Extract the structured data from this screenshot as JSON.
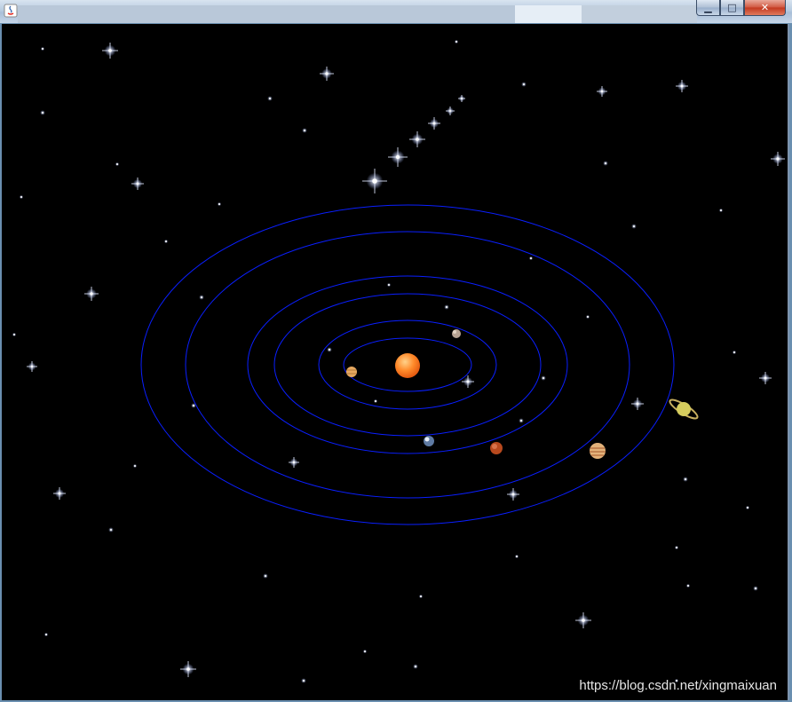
{
  "window": {
    "title": "",
    "buttons": {
      "minimize": "▁",
      "maximize": "□",
      "close": "✕"
    }
  },
  "scene": {
    "orbit_color": "#0a1fff",
    "background": "#000000",
    "sun": {
      "name": "sun",
      "color": "#ff7a1a"
    },
    "planets": [
      {
        "name": "mercury",
        "color": "#c9a98c"
      },
      {
        "name": "venus",
        "color": "#e8b36a"
      },
      {
        "name": "earth",
        "color": "#6e86a8"
      },
      {
        "name": "mars",
        "color": "#b8491e"
      },
      {
        "name": "jupiter",
        "color": "#e0a96a"
      },
      {
        "name": "saturn",
        "color": "#d8cc60"
      }
    ]
  },
  "watermark": "https://blog.csdn.net/xingmaixuan"
}
